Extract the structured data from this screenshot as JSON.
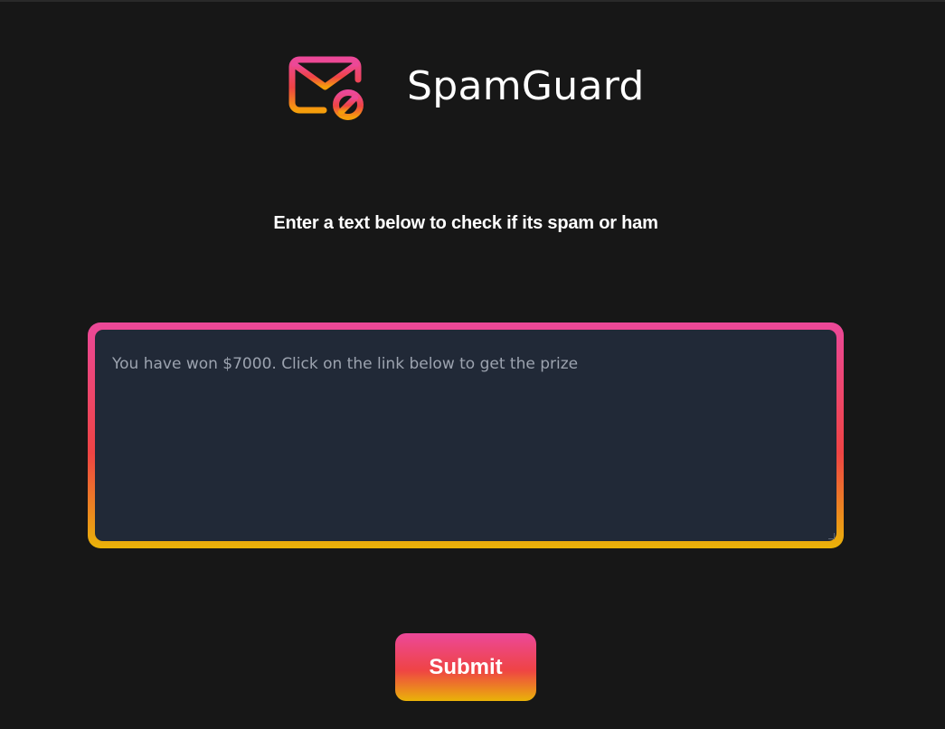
{
  "app": {
    "title": "SpamGuard",
    "logo_icon": "mail-blocked-icon"
  },
  "main": {
    "instruction": "Enter a text below to check if its spam or ham",
    "message_input": {
      "value": "",
      "placeholder": "You have won $7000. Click on the link below to get the prize"
    },
    "submit_label": "Submit"
  },
  "colors": {
    "background": "#171717",
    "input_background": "#212937",
    "gradient_top": "#ec4899",
    "gradient_mid": "#ef4444",
    "gradient_bottom": "#eab308",
    "text": "#ffffff",
    "placeholder": "#9ca3af"
  }
}
